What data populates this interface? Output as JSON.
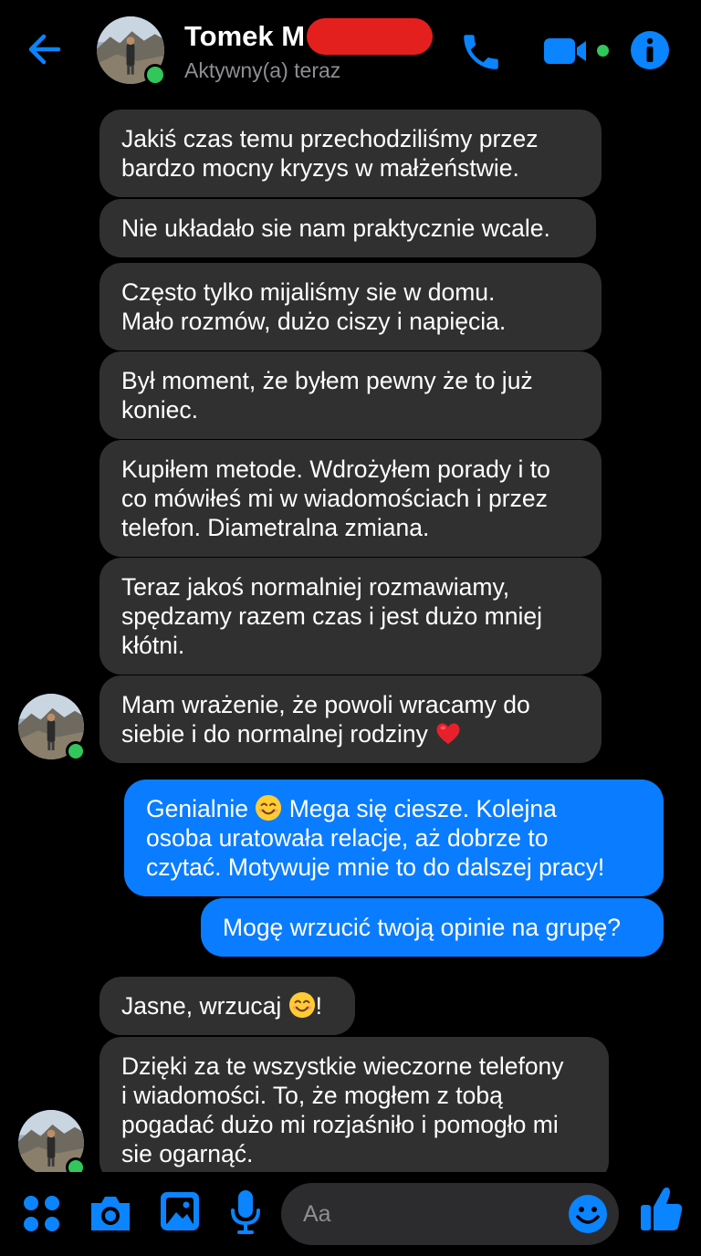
{
  "header": {
    "name": "Tomek M",
    "status": "Aktywny(a) teraz"
  },
  "messages": {
    "m1": [
      "Jakiś czas temu przechodziliśmy przez",
      "bardzo mocny kryzys w małżeństwie."
    ],
    "m2": [
      "Nie układało sie nam praktycznie wcale."
    ],
    "m3": [
      "Często tylko mijaliśmy sie w domu.",
      "Mało rozmów, dużo ciszy i napięcia."
    ],
    "m4": [
      "Był moment, że byłem pewny że to już",
      "koniec."
    ],
    "m5": [
      "Kupiłem metode. Wdrożyłem porady i to",
      "co mówiłeś mi w wiadomościach i przez",
      "telefon. Diametralna zmiana."
    ],
    "m6": [
      "Teraz jakoś normalniej rozmawiamy,",
      "spędzamy razem czas i jest dużo mniej",
      "kłótni."
    ],
    "m7": [
      "Mam wrażenie, że powoli wracamy do",
      "siebie i do normalnej rodziny"
    ],
    "m8": [
      "Genialnie",
      "Mega się ciesze. Kolejna",
      "osoba uratowała relacje, aż dobrze to",
      "czytać.  Motywuje mnie to do dalszej pracy!"
    ],
    "m9": [
      "Mogę wrzucić twoją opinie na grupę?"
    ],
    "m10": [
      "Jasne, wrzucaj",
      "!"
    ],
    "m11": [
      "Dzięki za te wszystkie wieczorne telefony",
      "i wiadomości. To, że mogłem z tobą",
      "pogadać dużo mi rozjaśniło i pomogło mi",
      "sie ogarnąć."
    ]
  },
  "composer": {
    "placeholder": "Aa"
  },
  "colors": {
    "accent": "#0a7cff",
    "incoming_bubble": "#303030",
    "online": "#31c75a",
    "redaction": "#e4201f"
  },
  "icons": [
    "back-arrow-icon",
    "phone-icon",
    "video-camera-icon",
    "info-icon",
    "apps-grid-icon",
    "camera-icon",
    "gallery-icon",
    "microphone-icon",
    "emoji-icon",
    "thumbs-up-icon",
    "red-heart-emoji",
    "smiling-face-emoji"
  ]
}
